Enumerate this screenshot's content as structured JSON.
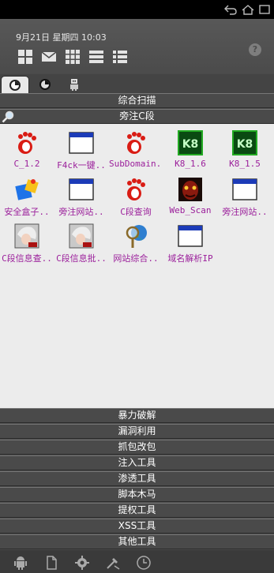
{
  "status_bar": {
    "icons": [
      "back-icon",
      "home-icon",
      "recent-apps-icon"
    ]
  },
  "header": {
    "datetime": "9月21日 星期四 10:03",
    "quick_icons": [
      "tiles-icon",
      "mail-icon",
      "grid-icon",
      "list-icon",
      "detail-list-icon"
    ],
    "help_label": "?"
  },
  "tabs": [
    {
      "icon": "disc-icon",
      "active": true
    },
    {
      "icon": "disc-icon",
      "active": false
    },
    {
      "icon": "robot-icon",
      "active": false
    }
  ],
  "categories": {
    "top": "综合扫描",
    "current": "旁注C段",
    "rest": [
      "暴力破解",
      "漏洞利用",
      "抓包改包",
      "注入工具",
      "渗透工具",
      "脚本木马",
      "提权工具",
      "XSS工具",
      "其他工具"
    ]
  },
  "colors": {
    "label": "#9b1f9b",
    "panel": "#ececec",
    "bar": "#4a4a4a"
  },
  "tools": [
    {
      "label": "C_1.2",
      "icon": "foot-icon"
    },
    {
      "label": "F4ck一键..",
      "icon": "window-icon"
    },
    {
      "label": "SubDomain..",
      "icon": "foot-icon"
    },
    {
      "label": "K8_1.6",
      "icon": "k8-icon"
    },
    {
      "label": "K8_1.5",
      "icon": "k8-icon"
    },
    {
      "label": "安全盒子..",
      "icon": "box-icon"
    },
    {
      "label": "旁注网站..",
      "icon": "window-icon"
    },
    {
      "label": "C段查询",
      "icon": "foot-icon"
    },
    {
      "label": "Web_Scan",
      "icon": "demon-icon"
    },
    {
      "label": "旁注网站..",
      "icon": "window-icon"
    },
    {
      "label": "C段信息查..",
      "icon": "anime-icon"
    },
    {
      "label": "C段信息批..",
      "icon": "anime-icon"
    },
    {
      "label": "网站综合..",
      "icon": "magnifier-globe-icon"
    },
    {
      "label": "域名解析IP",
      "icon": "window-icon"
    }
  ],
  "bottom_nav": [
    "android-icon",
    "document-icon",
    "gear-icon",
    "tools-icon",
    "clock-icon"
  ]
}
